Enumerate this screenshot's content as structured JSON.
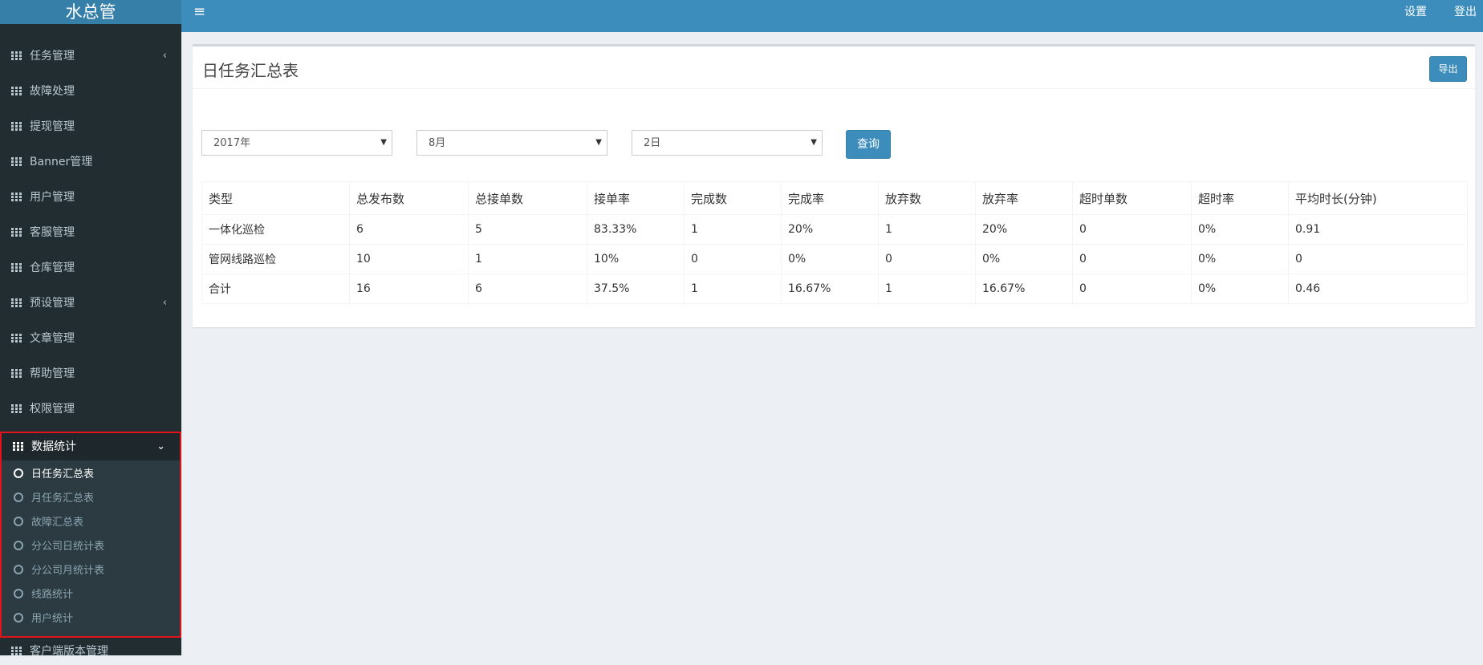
{
  "app": {
    "title": "水总管"
  },
  "colors": {
    "sidebar_bg": "#222d32",
    "topbar_bg": "#3c8dbc",
    "highlight_border": "#e0141a"
  },
  "sidebar": {
    "items": [
      {
        "label": "任务管理",
        "icon": "grid-icon",
        "chevron": "‹"
      },
      {
        "label": "故障处理",
        "icon": "grid-icon"
      },
      {
        "label": "提现管理",
        "icon": "grid-icon"
      },
      {
        "label": "Banner管理",
        "icon": "grid-icon"
      },
      {
        "label": "用户管理",
        "icon": "grid-icon"
      },
      {
        "label": "客服管理",
        "icon": "grid-icon"
      },
      {
        "label": "仓库管理",
        "icon": "grid-icon"
      },
      {
        "label": "预设管理",
        "icon": "grid-icon",
        "chevron": "‹"
      },
      {
        "label": "文章管理",
        "icon": "grid-icon"
      },
      {
        "label": "帮助管理",
        "icon": "grid-icon"
      },
      {
        "label": "权限管理",
        "icon": "grid-icon"
      }
    ],
    "active_group": {
      "label": "数据统计",
      "chevron": "⌄",
      "subitems": [
        {
          "label": "日任务汇总表",
          "current": true
        },
        {
          "label": "月任务汇总表"
        },
        {
          "label": "故障汇总表"
        },
        {
          "label": "分公司日统计表"
        },
        {
          "label": "分公司月统计表"
        },
        {
          "label": "线路统计"
        },
        {
          "label": "用户统计"
        }
      ]
    },
    "last_item": {
      "label": "客户端版本管理",
      "icon": "grid-icon"
    }
  },
  "topbar": {
    "menu_icon": "≡",
    "settings_label": "设置",
    "logout_label": "登出"
  },
  "main": {
    "title": "日任务汇总表",
    "export_label": "导出",
    "filters": {
      "year": "2017年",
      "month": "8月",
      "day": "2日"
    },
    "query_label": "查询",
    "table": {
      "headers": [
        "类型",
        "总发布数",
        "总接单数",
        "接单率",
        "完成数",
        "完成率",
        "放弃数",
        "放弃率",
        "超时单数",
        "超时率",
        "平均时长(分钟)"
      ],
      "rows": [
        [
          "一体化巡检",
          "6",
          "5",
          "83.33%",
          "1",
          "20%",
          "1",
          "20%",
          "0",
          "0%",
          "0.91"
        ],
        [
          "管网线路巡检",
          "10",
          "1",
          "10%",
          "0",
          "0%",
          "0",
          "0%",
          "0",
          "0%",
          "0"
        ],
        [
          "合计",
          "16",
          "6",
          "37.5%",
          "1",
          "16.67%",
          "1",
          "16.67%",
          "0",
          "0%",
          "0.46"
        ]
      ]
    }
  }
}
